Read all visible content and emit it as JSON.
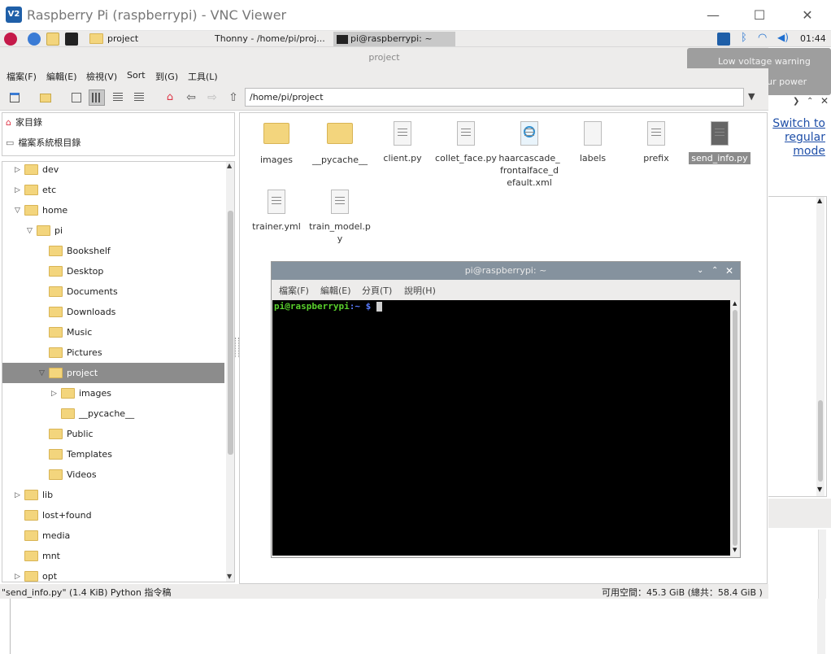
{
  "vnc": {
    "logo": "V2",
    "title": "Raspberry Pi (raspberrypi) - VNC Viewer",
    "minimize": "—",
    "maximize": "☐",
    "close": "✕"
  },
  "taskbar": {
    "items": [
      {
        "label": "project"
      },
      {
        "label": "Thonny  -  /home/pi/proj..."
      },
      {
        "label": "pi@raspberrypi: ~"
      }
    ],
    "clock": "01:44"
  },
  "notification": {
    "line1": "Low voltage warning",
    "line2": "Please check your power supply"
  },
  "file_manager": {
    "title": "project",
    "menu": [
      "檔案(F)",
      "編輯(E)",
      "檢視(V)",
      "Sort",
      "到(G)",
      "工具(L)"
    ],
    "path": "/home/pi/project",
    "places": [
      {
        "label": "家目錄",
        "icon": "home-icon"
      },
      {
        "label": "檔案系統根目錄",
        "icon": "drive-icon"
      }
    ],
    "tree": [
      {
        "label": "dev",
        "indent": 0,
        "arrow": "▷"
      },
      {
        "label": "etc",
        "indent": 0,
        "arrow": "▷"
      },
      {
        "label": "home",
        "indent": 0,
        "arrow": "▽"
      },
      {
        "label": "pi",
        "indent": 1,
        "arrow": "▽"
      },
      {
        "label": "Bookshelf",
        "indent": 2,
        "arrow": ""
      },
      {
        "label": "Desktop",
        "indent": 2,
        "arrow": ""
      },
      {
        "label": "Documents",
        "indent": 2,
        "arrow": ""
      },
      {
        "label": "Downloads",
        "indent": 2,
        "arrow": ""
      },
      {
        "label": "Music",
        "indent": 2,
        "arrow": ""
      },
      {
        "label": "Pictures",
        "indent": 2,
        "arrow": ""
      },
      {
        "label": "project",
        "indent": 2,
        "arrow": "▽",
        "selected": true
      },
      {
        "label": "images",
        "indent": 3,
        "arrow": "▷"
      },
      {
        "label": "__pycache__",
        "indent": 3,
        "arrow": ""
      },
      {
        "label": "Public",
        "indent": 2,
        "arrow": ""
      },
      {
        "label": "Templates",
        "indent": 2,
        "arrow": ""
      },
      {
        "label": "Videos",
        "indent": 2,
        "arrow": ""
      },
      {
        "label": "lib",
        "indent": 0,
        "arrow": "▷"
      },
      {
        "label": "lost+found",
        "indent": 0,
        "arrow": ""
      },
      {
        "label": "media",
        "indent": 0,
        "arrow": ""
      },
      {
        "label": "mnt",
        "indent": 0,
        "arrow": ""
      },
      {
        "label": "opt",
        "indent": 0,
        "arrow": "▷"
      }
    ],
    "files": [
      {
        "name": "images",
        "kind": "folder"
      },
      {
        "name": "__pycache__",
        "kind": "folder"
      },
      {
        "name": "client.py",
        "kind": "doc"
      },
      {
        "name": "collet_face.py",
        "kind": "doc"
      },
      {
        "name": "haarcascade_frontalface_default.xml",
        "kind": "xml"
      },
      {
        "name": "labels",
        "kind": "blank"
      },
      {
        "name": "prefix",
        "kind": "doc"
      },
      {
        "name": "send_info.py",
        "kind": "doc",
        "selected": true
      },
      {
        "name": "trainer.yml",
        "kind": "doc"
      },
      {
        "name": "train_model.py",
        "kind": "doc"
      }
    ],
    "status_left": "\"send_info.py\" (1.4 KiB) Python 指令稿",
    "status_right": "可用空間：45.3 GiB (總共：58.4 GiB )"
  },
  "terminal": {
    "title": "pi@raspberrypi: ~",
    "menu": [
      "檔案(F)",
      "編輯(E)",
      "分頁(T)",
      "說明(H)"
    ],
    "prompt_user": "pi@raspberrypi",
    "prompt_path": ":~ $",
    "colors": {
      "user": "#59d02c",
      "path": "#5a7cff"
    }
  },
  "right_panel": {
    "link": "Switch to regular mode"
  }
}
